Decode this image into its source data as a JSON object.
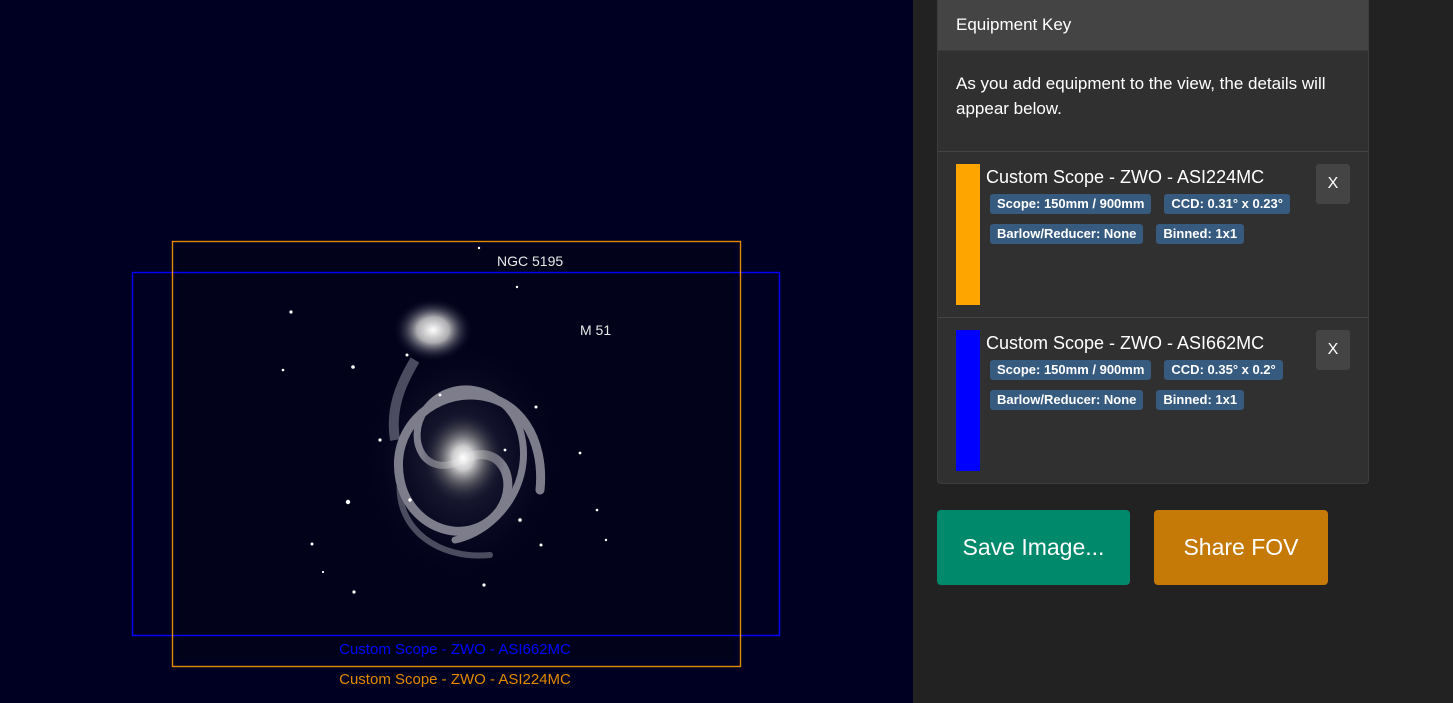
{
  "sky": {
    "objects": [
      "NGC 5195",
      "M 51"
    ]
  },
  "fov_overlays": [
    {
      "label": "Custom Scope - ZWO - ASI662MC",
      "color": "#0000ff"
    },
    {
      "label": "Custom Scope - ZWO - ASI224MC",
      "color": "#e08a00"
    }
  ],
  "panel": {
    "title": "Equipment Key",
    "intro": "As you add equipment to the view, the details will appear below.",
    "items": [
      {
        "name": "Custom Scope - ZWO - ASI224MC",
        "color": "#ffa500",
        "badges": [
          "Scope: 150mm / 900mm",
          "CCD: 0.31° x 0.23°",
          "Barlow/Reducer: None",
          "Binned: 1x1"
        ],
        "close_label": "X"
      },
      {
        "name": "Custom Scope - ZWO - ASI662MC",
        "color": "#0000ff",
        "badges": [
          "Scope: 150mm / 900mm",
          "CCD: 0.35° x 0.2°",
          "Barlow/Reducer: None",
          "Binned: 1x1"
        ],
        "close_label": "X"
      }
    ]
  },
  "actions": {
    "save_label": "Save Image...",
    "share_label": "Share FOV"
  }
}
